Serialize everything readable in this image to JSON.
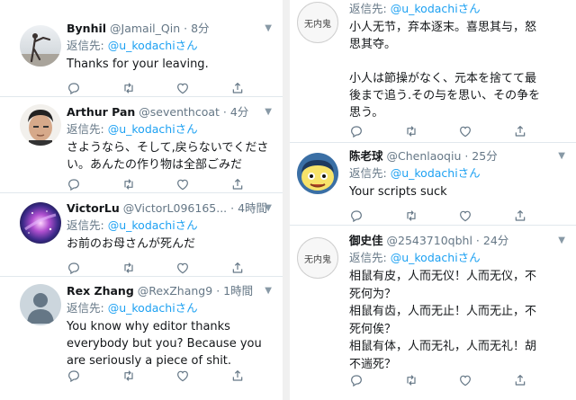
{
  "left_tweets": [
    {
      "name": "Bynhil",
      "handle": "@Jamail_Qin",
      "time": "· 8分",
      "reply_prefix": "返信先:",
      "reply_to": "@u_kodachiさん",
      "lines": [
        "Thanks for your leaving."
      ],
      "avatar": "photo-avatar-icon"
    },
    {
      "name": "Arthur Pan",
      "handle": "@seventhcoat",
      "time": "· 4分",
      "reply_prefix": "返信先:",
      "reply_to": "@u_kodachiさん",
      "lines": [
        "さようなら、そして,戻らないでくださ",
        "い。あんたの作り物は全部ごみだ"
      ],
      "avatar": "photo-avatar-icon"
    },
    {
      "name": "VictorLu",
      "handle": "@VictorL096165...",
      "time": "· 4時間",
      "reply_prefix": "返信先:",
      "reply_to": "@u_kodachiさん",
      "lines": [
        "お前のお母さんが死んだ"
      ],
      "avatar": "photo-avatar-icon"
    },
    {
      "name": "Rex Zhang",
      "handle": "@RexZhang9",
      "time": "· 1時間",
      "reply_prefix": "返信先:",
      "reply_to": "@u_kodachiさん",
      "lines": [
        "You know why editor thanks",
        "everybody but you? Because you",
        "are seriously a piece of shit."
      ],
      "avatar": "default-avatar-icon"
    }
  ],
  "right_tweets": [
    {
      "name": "",
      "handle": "",
      "time": "",
      "reply_prefix": "返信先:",
      "reply_to": "@u_kodachiさん",
      "lines": [
        "小人无节，弃本逐末。喜思其与，怒",
        "思其夺。",
        "",
        "小人は節操がなく、元本を捨てて最",
        "後まで追う.その与を思い、その争を",
        "思う。"
      ],
      "avatar_text": "无内鬼"
    },
    {
      "name": "陈老球",
      "handle": "@Chenlaoqiu",
      "time": "· 25分",
      "reply_prefix": "返信先:",
      "reply_to": "@u_kodachiさん",
      "lines": [
        "Your scripts suck"
      ],
      "avatar": "cartoon-avatar-icon"
    },
    {
      "name": "御史佳",
      "handle": "@2543710qbhl",
      "time": "· 24分",
      "reply_prefix": "返信先:",
      "reply_to": "@u_kodachiさん",
      "lines": [
        "相鼠有皮，人而无仪！人而无仪，不",
        "死何为？",
        "相鼠有齿，人而无止！人而无止，不",
        "死何俟？",
        "相鼠有体，人而无礼，人而无礼！胡",
        "不遄死？"
      ],
      "avatar_text": "无内鬼"
    }
  ],
  "colors": {
    "link": "#1da1f2",
    "secondary": "#657786",
    "border": "#e1e8ed"
  }
}
